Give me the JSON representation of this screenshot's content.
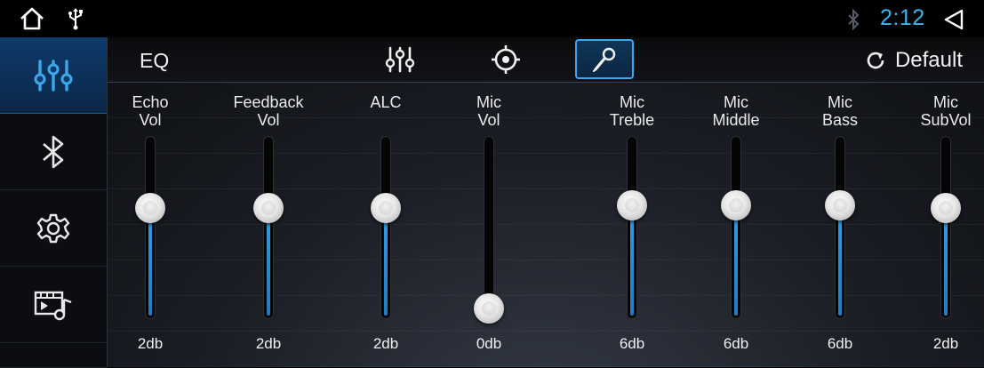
{
  "status_bar": {
    "time": "2:12",
    "icons": [
      "home-icon",
      "usb-icon",
      "bluetooth-icon",
      "back-icon"
    ]
  },
  "sidebar": {
    "items": [
      {
        "icon": "equalizer-icon",
        "active": true
      },
      {
        "icon": "bluetooth-icon",
        "active": false
      },
      {
        "icon": "gear-icon",
        "active": false
      },
      {
        "icon": "media-icon",
        "active": false
      }
    ]
  },
  "header": {
    "title": "EQ",
    "tabs": [
      {
        "icon": "equalizer-icon",
        "selected": false
      },
      {
        "icon": "target-icon",
        "selected": false
      },
      {
        "icon": "microphone-icon",
        "selected": true
      }
    ],
    "default_label": "Default",
    "default_icon": "refresh-icon"
  },
  "colors": {
    "accent": "#3aa8ea",
    "clock": "#3cb4f0",
    "track_fill": "#2f9fe8",
    "background": "#000000"
  },
  "sliders": [
    {
      "line1": "Echo",
      "line2": "Vol",
      "value": "2db",
      "level": 0.62
    },
    {
      "line1": "Feedback",
      "line2": "Vol",
      "value": "2db",
      "level": 0.62
    },
    {
      "line1": "",
      "line2": "ALC",
      "value": "2db",
      "level": 0.62
    },
    {
      "line1": "Mic",
      "line2": "Vol",
      "value": "0db",
      "level": 0.0
    },
    {
      "line1": "Mic",
      "line2": "Treble",
      "value": "6db",
      "level": 0.64
    },
    {
      "line1": "Mic",
      "line2": "Middle",
      "value": "6db",
      "level": 0.64
    },
    {
      "line1": "Mic",
      "line2": "Bass",
      "value": "6db",
      "level": 0.64
    },
    {
      "line1": "Mic",
      "line2": "SubVol",
      "value": "2db",
      "level": 0.62
    }
  ]
}
